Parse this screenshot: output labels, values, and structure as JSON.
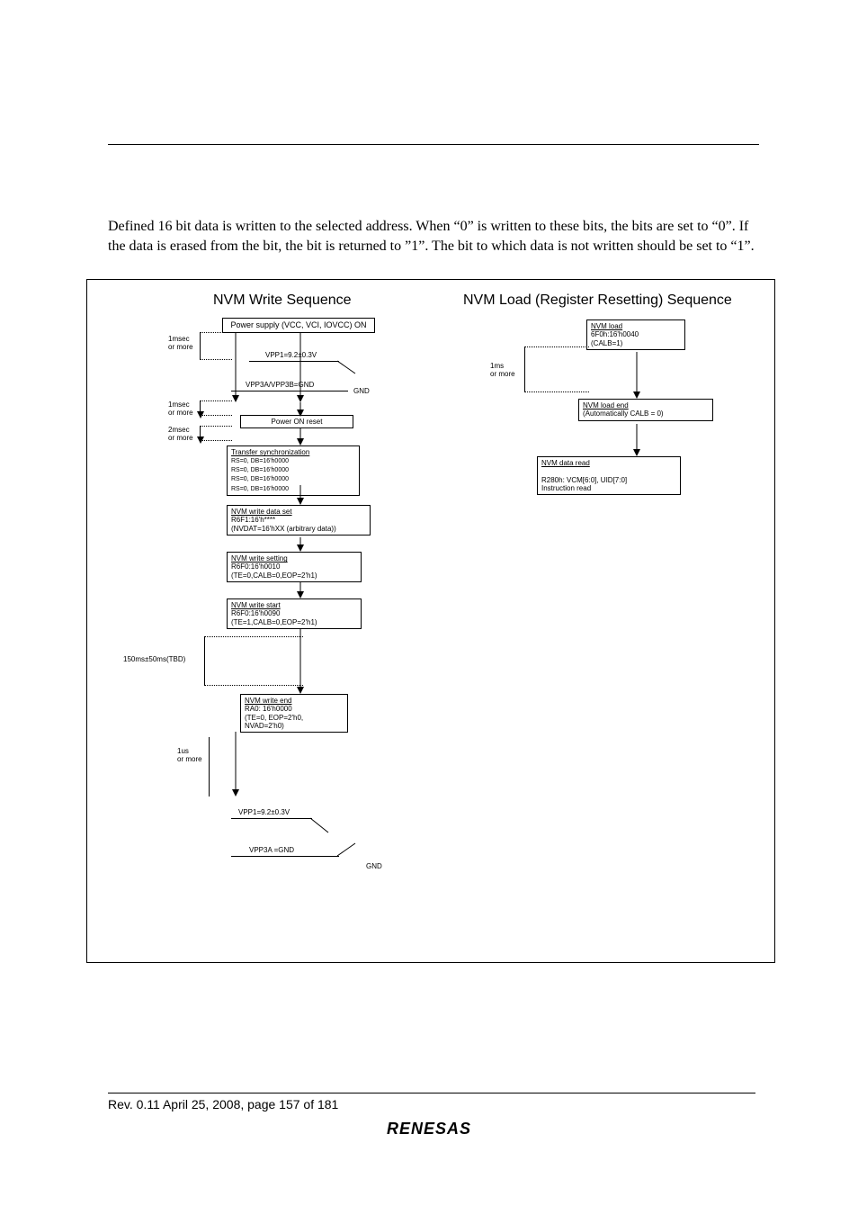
{
  "paragraph": "Defined 16 bit data is written to the selected address.  When “0” is written to these bits, the bits are set to “0”.  If the data is erased from the bit, the bit is returned to ”1”.  The bit to which data is not written should be set to “1”.",
  "chart_data": {
    "type": "diagram",
    "titles": {
      "left": "NVM Write Sequence",
      "right": "NVM Load (Register Resetting) Sequence"
    },
    "left_sequence": [
      {
        "id": "power-supply",
        "title": "Power supply (VCC, VCI, IOVCC) ON"
      },
      {
        "id": "vpp1-up",
        "label": "VPP1=9.2±0.3V"
      },
      {
        "id": "vpp3a-gnd-up",
        "label": "VPP3A/VPP3B=GND",
        "sub": "GND"
      },
      {
        "id": "power-on-reset",
        "title": "Power ON reset"
      },
      {
        "id": "transfer-sync",
        "title": "Transfer synchronization",
        "body": "RS=0, DB=16'h0000\nRS=0, DB=16'h0000\nRS=0, DB=16'h0000\nRS=0, DB=16'h0000"
      },
      {
        "id": "write-data-set",
        "title": "NVM write data set",
        "body": "R6F1:16'h****\n(NVDAT=16'hXX (arbitrary data))"
      },
      {
        "id": "write-setting",
        "title": "NVM write setting",
        "body": "R6F0:16'h0010\n(TE=0,CALB=0,EOP=2'h1)"
      },
      {
        "id": "write-start",
        "title": "NVM write start",
        "body": "R6F0:16'h0090\n(TE=1,CALB=0,EOP=2'h1)"
      },
      {
        "id": "write-end",
        "title": "NVM write end",
        "body": "RA0: 16'h0000\n(TE=0, EOP=2'h0,\nNVAD=2'h0)"
      },
      {
        "id": "vpp1-down",
        "label": "VPP1=9.2±0.3V"
      },
      {
        "id": "vpp3a-gnd-down",
        "label": "VPP3A =GND",
        "sub": "GND"
      }
    ],
    "left_timings": [
      {
        "label": "1msec\nor more"
      },
      {
        "label": "1msec\nor more"
      },
      {
        "label": "2msec\nor more"
      },
      {
        "label": "150ms±50ms(TBD)"
      },
      {
        "label": "1us\nor more"
      }
    ],
    "right_sequence": [
      {
        "id": "nvm-load",
        "title": "NVM load",
        "body": "6F0h:16'h0040\n(CALB=1)"
      },
      {
        "id": "nvm-load-end",
        "title": "NVM load end",
        "body": "(Automatically CALB = 0)"
      },
      {
        "id": "nvm-data-read",
        "title": "NVM data read",
        "body": "R280h: VCM[6:0], UID[7:0]\nInstruction read"
      }
    ],
    "right_timings": [
      {
        "label": "1ms\nor more"
      }
    ]
  },
  "footer": "Rev. 0.11 April 25, 2008, page 157 of 181",
  "logo": "RENESAS"
}
